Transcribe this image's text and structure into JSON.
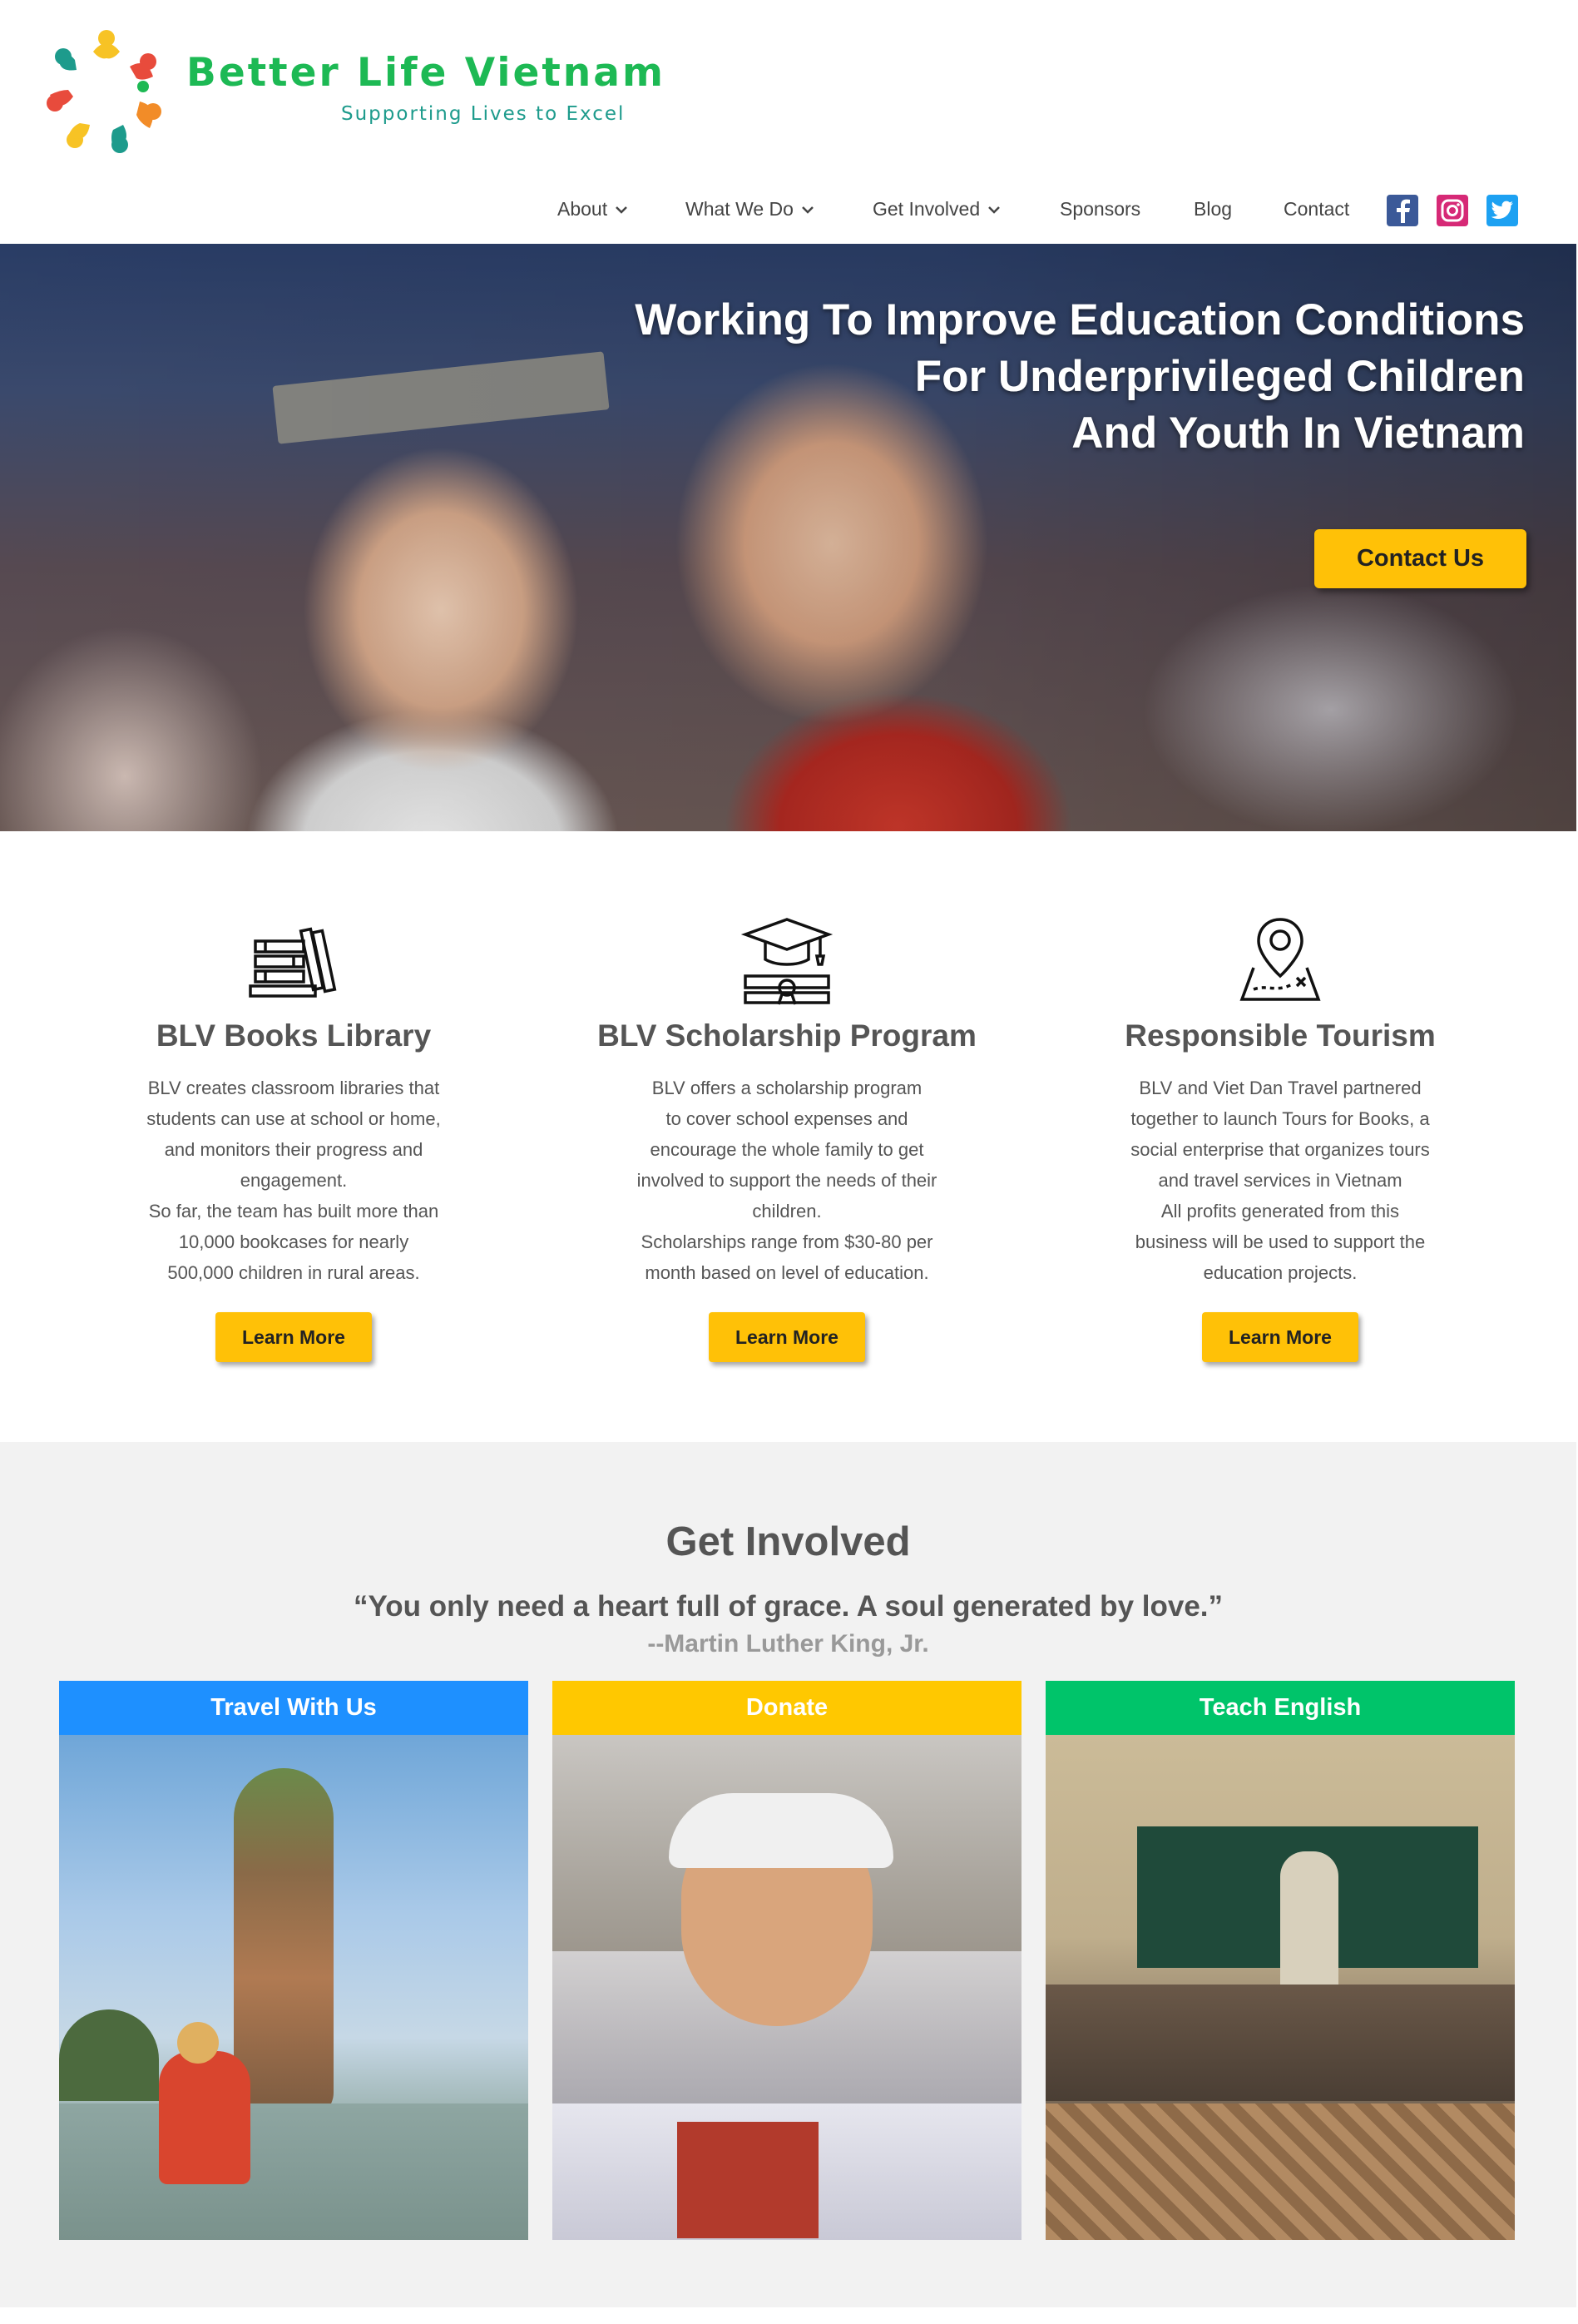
{
  "brand": {
    "name": "Better Life Vietnam",
    "tagline": "Supporting Lives to Excel",
    "colors": {
      "green": "#1db954",
      "teal": "#1d9b8c"
    }
  },
  "nav": {
    "items": [
      {
        "label": "About",
        "dropdown": true
      },
      {
        "label": "What We Do",
        "dropdown": true
      },
      {
        "label": "Get Involved",
        "dropdown": true
      },
      {
        "label": "Sponsors",
        "dropdown": false
      },
      {
        "label": "Blog",
        "dropdown": false
      },
      {
        "label": "Contact",
        "dropdown": false
      }
    ],
    "social": [
      "facebook-icon",
      "instagram-icon",
      "twitter-icon"
    ]
  },
  "hero": {
    "title_lines": [
      "Working To Improve Education Conditions",
      "For Underprivileged Children",
      "And Youth In Vietnam"
    ],
    "cta_label": "Contact Us",
    "accent": "#ffc107"
  },
  "features": [
    {
      "icon": "books-icon",
      "title": "BLV Books Library",
      "lines": [
        "BLV creates classroom libraries that",
        "students can use at school or home,",
        "and monitors their progress and",
        "engagement.",
        "So far, the team has built more than",
        "10,000 bookcases for nearly",
        "500,000 children in rural areas."
      ],
      "button": "Learn More"
    },
    {
      "icon": "graduation-cap-icon",
      "title": "BLV Scholarship Program",
      "lines": [
        "BLV offers a scholarship program",
        "to cover school expenses and",
        "encourage the whole family to get",
        "involved to support the needs of their",
        "children.",
        "Scholarships range from $30-80 per",
        "month based on level of education."
      ],
      "button": "Learn More"
    },
    {
      "icon": "map-pin-icon",
      "title": "Responsible Tourism",
      "lines": [
        "BLV and Viet Dan Travel partnered",
        "together to launch Tours for Books, a",
        "social enterprise that organizes tours",
        "and travel services in Vietnam",
        "All profits generated from this",
        "business will be used to support the",
        "education projects."
      ],
      "button": "Learn More"
    }
  ],
  "involved": {
    "title": "Get Involved",
    "quote": "“You only need a heart full of grace. A soul generated by love.”",
    "author": "--Martin Luther King, Jr.",
    "cards": [
      {
        "label": "Travel With Us",
        "color": "#1e90ff"
      },
      {
        "label": "Donate",
        "color": "#ffc800"
      },
      {
        "label": "Teach English",
        "color": "#00c46a"
      }
    ]
  }
}
